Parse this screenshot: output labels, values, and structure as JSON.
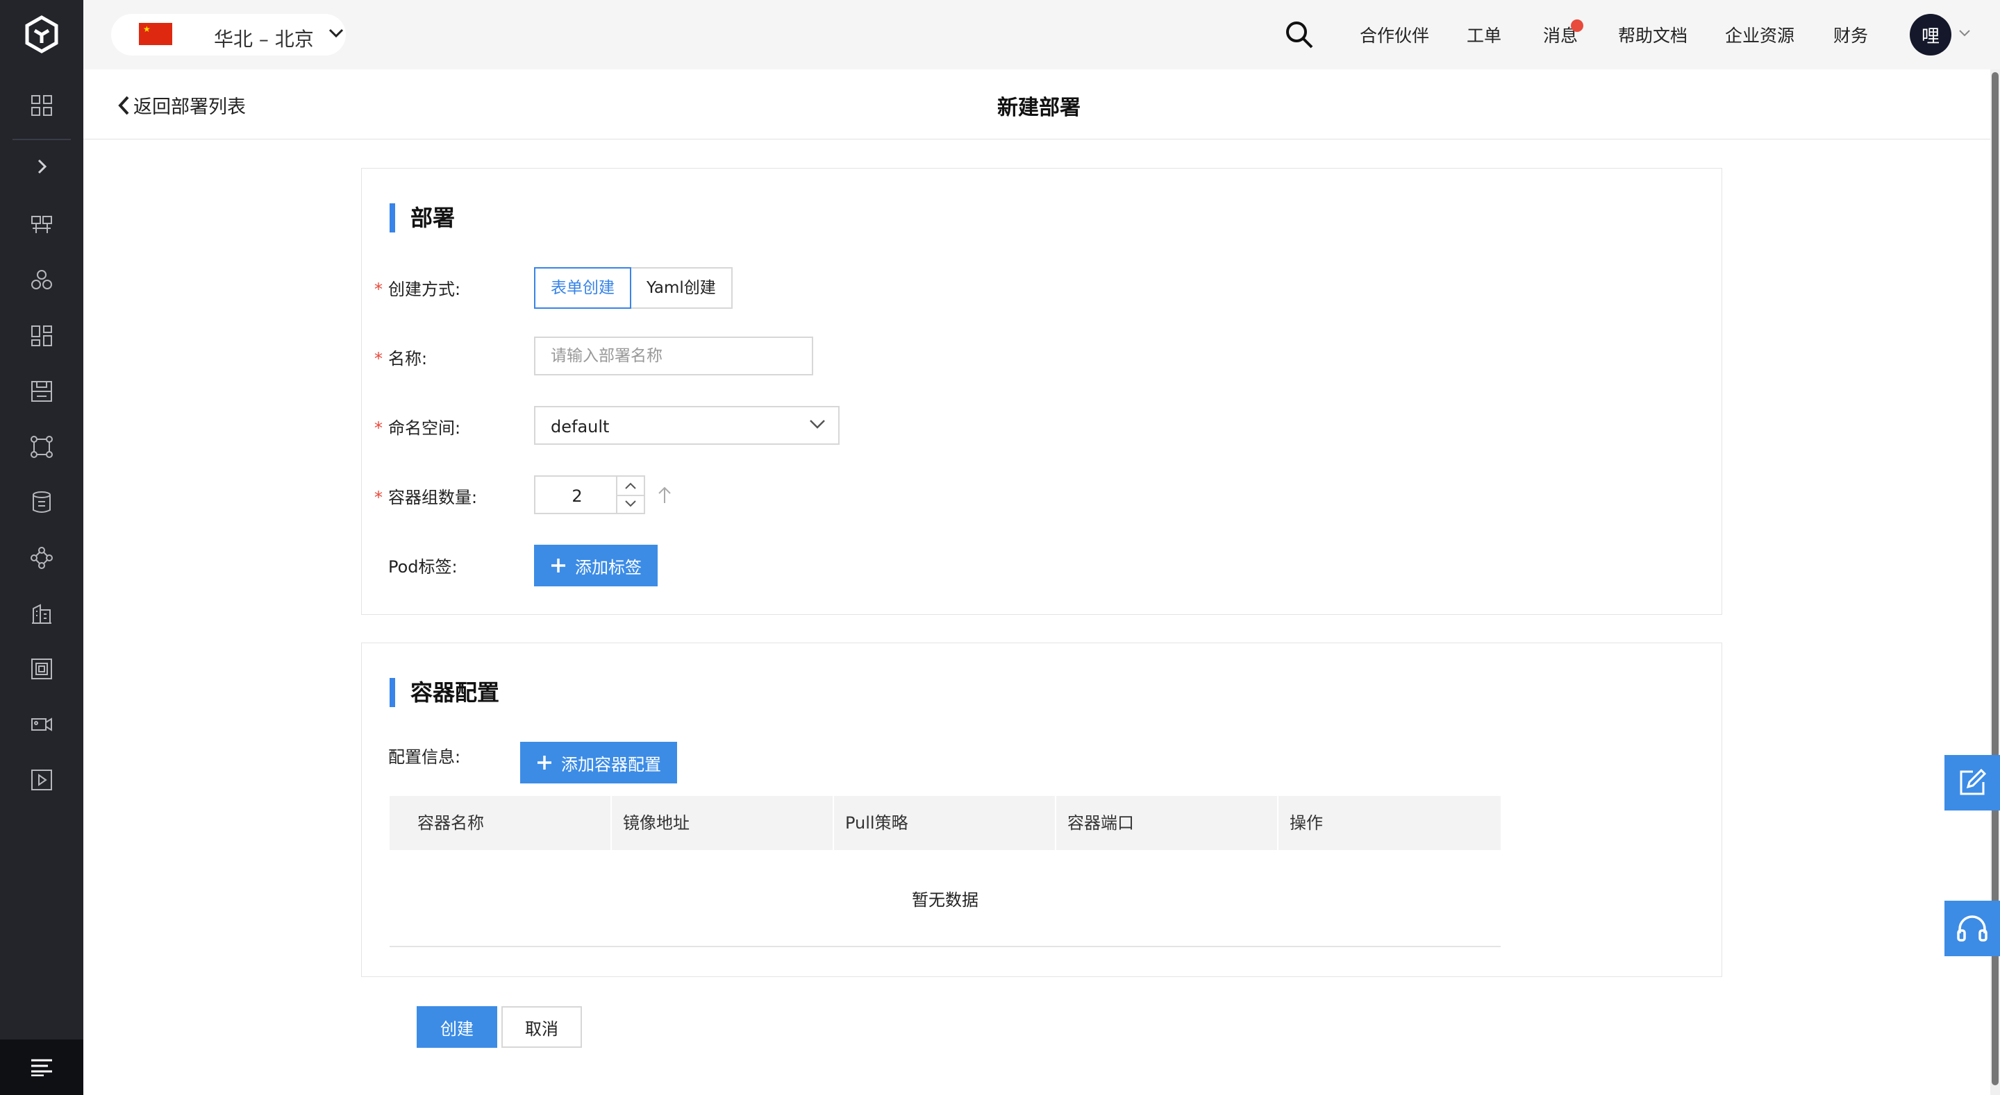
{
  "header": {
    "region_label": "华北 – 北京",
    "nav": [
      "合作伙伴",
      "工单",
      "消息",
      "帮助文档",
      "企业资源",
      "财务"
    ],
    "avatar_text": "哩"
  },
  "subheader": {
    "back_label": "返回部署列表",
    "title": "新建部署"
  },
  "deploy_section": {
    "title": "部署",
    "create_method_label": "创建方式:",
    "create_method_options": [
      "表单创建",
      "Yaml创建"
    ],
    "create_method_selected": "表单创建",
    "name_label": "名称:",
    "name_placeholder": "请输入部署名称",
    "namespace_label": "命名空间:",
    "namespace_value": "default",
    "replicas_label": "容器组数量:",
    "replicas_value": "2",
    "pod_labels_label": "Pod标签:",
    "add_label_button": "添加标签"
  },
  "container_section": {
    "title": "容器配置",
    "config_label": "配置信息:",
    "add_config_button": "添加容器配置",
    "table_columns": [
      "容器名称",
      "镜像地址",
      "Pull策略",
      "容器端口",
      "操作"
    ],
    "empty_text": "暂无数据"
  },
  "footer": {
    "create_button": "创建",
    "cancel_button": "取消"
  },
  "colors": {
    "primary": "#3c8ce6",
    "sidebar": "#23252b",
    "required": "#e84a3c"
  },
  "icons": {
    "sidebar": [
      "dashboard-icon",
      "expand-icon",
      "cluster-icon",
      "user-group-icon",
      "apps-icon",
      "storage-icon",
      "network-icon",
      "database-icon",
      "topology-icon",
      "building-icon",
      "server-icon",
      "video-icon",
      "play-icon"
    ]
  }
}
